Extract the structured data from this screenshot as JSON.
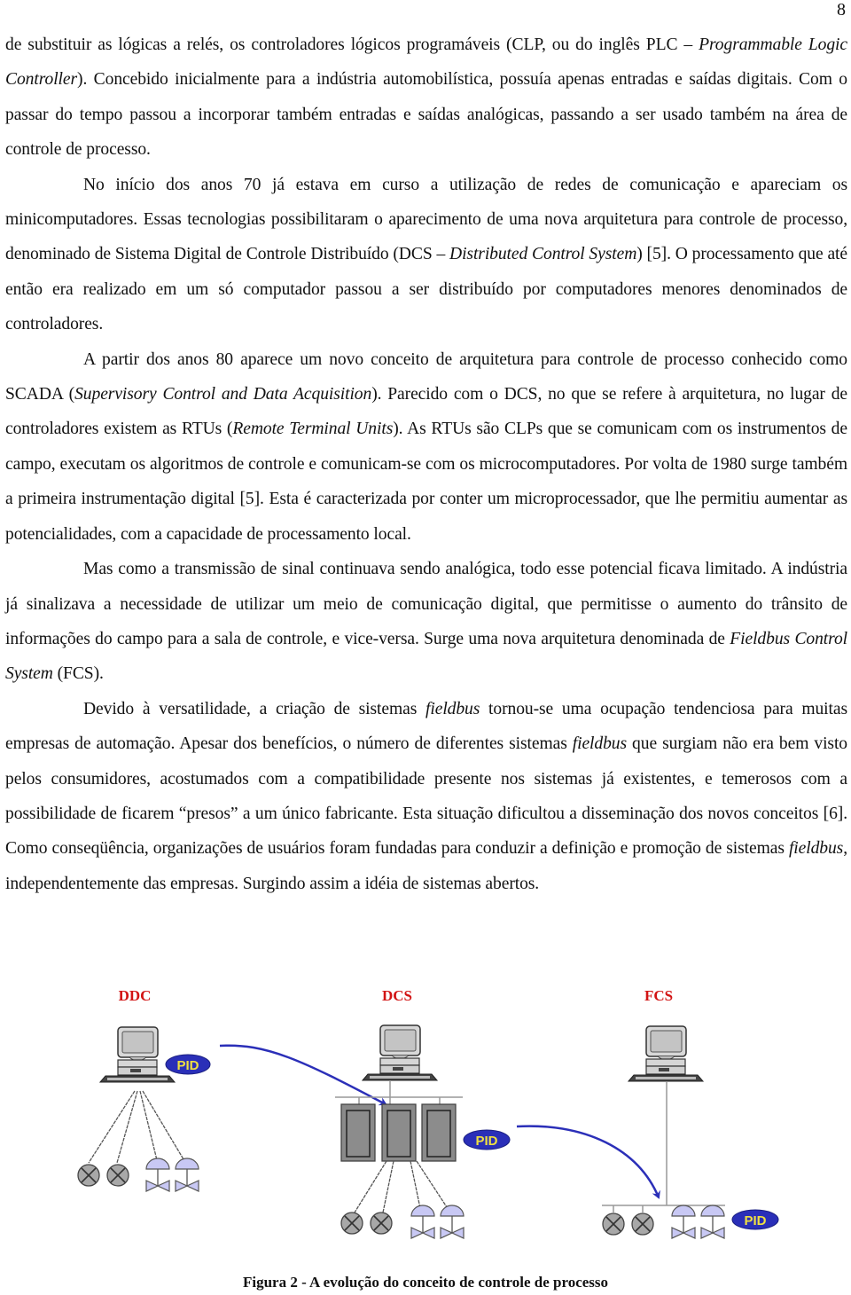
{
  "page": {
    "number": "8"
  },
  "paragraphs": [
    {
      "indent": false,
      "segments": [
        {
          "text": "de substituir as lógicas a relés, os controladores lógicos programáveis (CLP, ou do inglês PLC – ",
          "italic": false
        },
        {
          "text": "Programmable Logic Controller",
          "italic": true
        },
        {
          "text": "). Concebido inicialmente para a indústria automobilística, possuía apenas entradas e saídas digitais. Com o passar do tempo passou a incorporar também entradas e saídas analógicas, passando a ser usado também na área de controle de processo.",
          "italic": false
        }
      ]
    },
    {
      "indent": true,
      "segments": [
        {
          "text": "No início dos anos 70 já estava em curso a utilização de redes de comunicação e apareciam os minicomputadores. Essas tecnologias possibilitaram o aparecimento de uma nova arquitetura para controle de processo, denominado de Sistema Digital de Controle Distribuído (DCS – ",
          "italic": false
        },
        {
          "text": "Distributed Control System",
          "italic": true
        },
        {
          "text": ") [5]. O processamento que até então era realizado em um só computador passou a ser distribuído por computadores menores denominados de controladores.",
          "italic": false
        }
      ]
    },
    {
      "indent": true,
      "segments": [
        {
          "text": "A partir dos anos 80 aparece um novo conceito de arquitetura para controle de processo conhecido como SCADA (",
          "italic": false
        },
        {
          "text": "Supervisory Control and Data Acquisition",
          "italic": true
        },
        {
          "text": "). Parecido com o DCS, no que se refere à arquitetura, no lugar de controladores existem as RTUs (",
          "italic": false
        },
        {
          "text": "Remote Terminal Units",
          "italic": true
        },
        {
          "text": "). As RTUs são CLPs que se comunicam com os instrumentos de campo, executam os algoritmos de controle e comunicam-se com os microcomputadores. Por volta de 1980 surge também a primeira instrumentação digital [5]. Esta é caracterizada por conter um microprocessador, que lhe permitiu aumentar as potencialidades, com a capacidade de processamento local.",
          "italic": false
        }
      ]
    },
    {
      "indent": true,
      "segments": [
        {
          "text": "Mas como a transmissão de sinal continuava sendo analógica, todo esse potencial ficava limitado. A indústria já sinalizava a necessidade de utilizar um meio de comunicação digital, que permitisse o aumento do trânsito de informações do campo para a sala de controle, e vice-versa. Surge uma nova arquitetura denominada de ",
          "italic": false
        },
        {
          "text": "Fieldbus Control System",
          "italic": true
        },
        {
          "text": " (FCS).",
          "italic": false
        }
      ]
    },
    {
      "indent": true,
      "segments": [
        {
          "text": "Devido à versatilidade, a criação de sistemas ",
          "italic": false
        },
        {
          "text": "fieldbus",
          "italic": true
        },
        {
          "text": " tornou-se uma ocupação tendenciosa para muitas empresas de automação. Apesar dos benefícios, o número de diferentes sistemas ",
          "italic": false
        },
        {
          "text": "fieldbus",
          "italic": true
        },
        {
          "text": " que surgiam não era bem visto pelos consumidores, acostumados com a compatibilidade presente nos sistemas já existentes, e temerosos com a possibilidade de ficarem “presos” a um único fabricante. Esta situação dificultou a disseminação dos novos conceitos [6]. Como conseqüência, organizações de usuários foram fundadas para conduzir a definição e promoção de sistemas ",
          "italic": false
        },
        {
          "text": "fieldbus",
          "italic": true
        },
        {
          "text": ", independentemente das empresas. Surgindo assim a idéia de sistemas abertos.",
          "italic": false
        }
      ]
    }
  ],
  "figure": {
    "stages": [
      {
        "label": "DDC",
        "badge": "PID"
      },
      {
        "label": "DCS",
        "badge": "PID"
      },
      {
        "label": "FCS",
        "badge": "PID"
      }
    ],
    "colors": {
      "stage_label": "#d21414",
      "arrow": "#2b2fb8",
      "badge_fill": "#2a2fb8",
      "badge_text": "#f0e040",
      "valve_fill": "#c8c8f4",
      "sensor_fill": "#a8a8a8",
      "controller_fill": "#8a8a8a"
    },
    "icons": [
      "computer-workstation-icon",
      "controller-cabinet-icon",
      "sensor-transmitter-icon",
      "control-valve-icon",
      "transition-arrow-icon"
    ],
    "caption": "Figura 2 - A evolução do conceito de controle de processo"
  }
}
